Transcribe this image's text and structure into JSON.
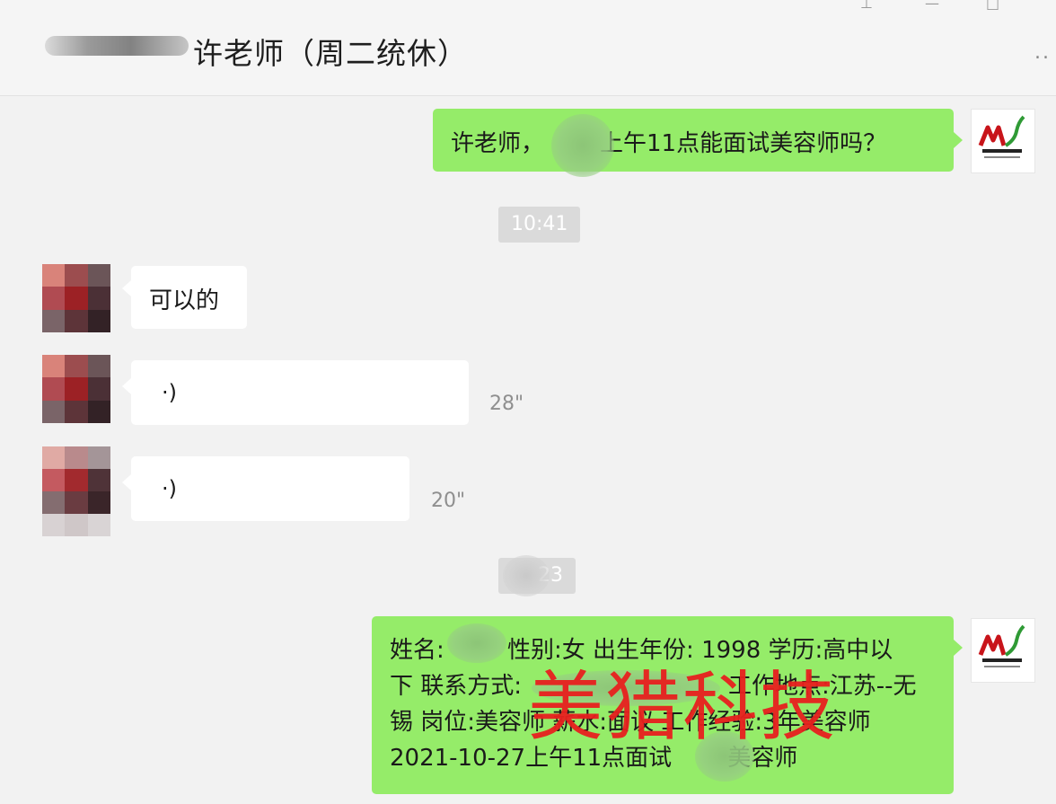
{
  "header": {
    "title": "许老师（周二统休）",
    "more": "..",
    "window_controls": [
      "pin-icon",
      "minimize-icon",
      "maximize-icon",
      "close-icon"
    ]
  },
  "messages": {
    "m1": {
      "side": "right",
      "text_before": "许老师，",
      "text_after": "上午11点能面试美容师吗？"
    },
    "ts1": "10:41",
    "m2": {
      "side": "left",
      "text": "可以的"
    },
    "m3": {
      "side": "left",
      "type": "voice",
      "duration": "28\""
    },
    "m4": {
      "side": "left",
      "type": "voice",
      "duration": "20\""
    },
    "ts2": "23",
    "m5": {
      "side": "right",
      "line1_a": "姓名:",
      "line1_b": " 性别:女 出生年份: 1998 学历:高中以",
      "line2_a": "下 联系方式:",
      "line2_b": "工作地点:江苏--无",
      "line3": "锡 岗位:美容师 薪水:面议 工作经验:3年美容师",
      "line4_a": "2021-10-27上午11点面试",
      "line4_b": "美容师"
    }
  },
  "watermark": "美猎科技",
  "colors": {
    "green_bubble": "#95ec69",
    "background": "#f2f2f2",
    "watermark": "#e8201f"
  }
}
